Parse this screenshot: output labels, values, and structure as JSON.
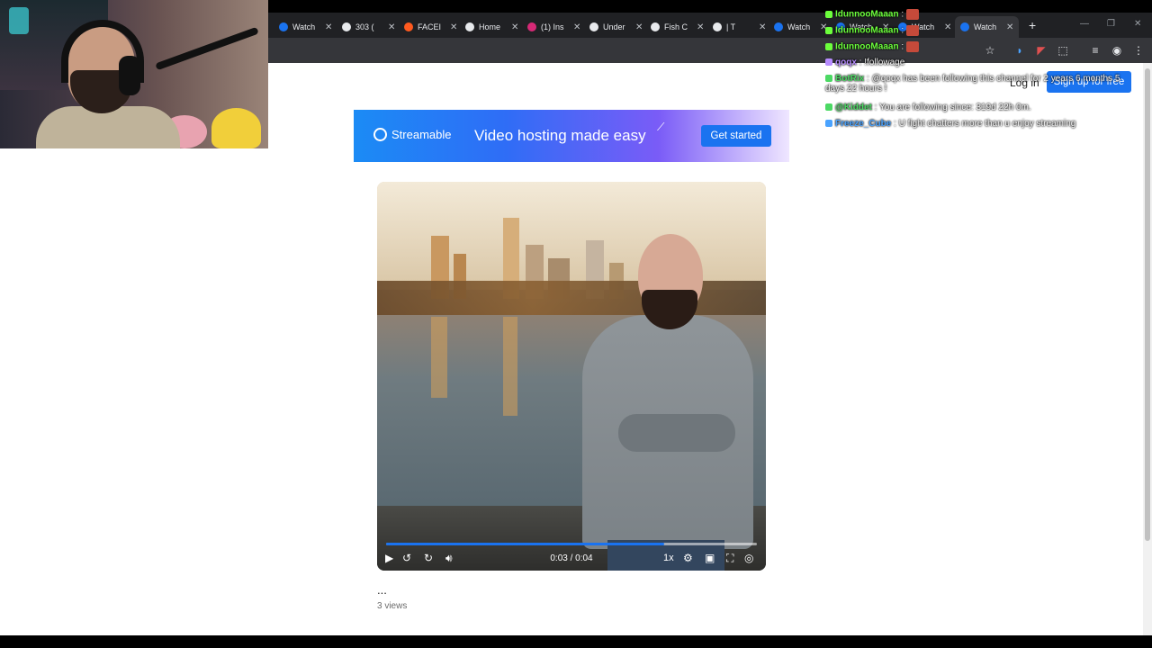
{
  "browser": {
    "tabs": [
      {
        "title": "Watch",
        "favicon_color": "#1a73f0"
      },
      {
        "title": "303 (",
        "favicon_color": "#e8eaed"
      },
      {
        "title": "FACEI",
        "favicon_color": "#ff5a1f"
      },
      {
        "title": "Home",
        "favicon_color": "#e8eaed"
      },
      {
        "title": "(1) Ins",
        "favicon_color": "#d62976"
      },
      {
        "title": "Under",
        "favicon_color": "#e8eaed"
      },
      {
        "title": "Fish C",
        "favicon_color": "#e8eaed"
      },
      {
        "title": "| T",
        "favicon_color": "#e8eaed"
      },
      {
        "title": "Watch",
        "favicon_color": "#1a73f0"
      },
      {
        "title": "Watch",
        "favicon_color": "#1a73f0"
      },
      {
        "title": "Watch",
        "favicon_color": "#1a73f0"
      },
      {
        "title": "Watch",
        "favicon_color": "#1a73f0",
        "active": true
      }
    ],
    "new_tab": "+",
    "close_glyph": "✕"
  },
  "header": {
    "login_label": "Log in",
    "signup_label": "Sign up for free"
  },
  "banner": {
    "brand": "Streamable",
    "tagline": "Video hosting made easy",
    "cta_label": "Get started"
  },
  "player": {
    "time": "0:03 / 0:04",
    "progress": 0.75,
    "speed": "1x"
  },
  "video": {
    "title": "...",
    "views": "3 views"
  },
  "chat": {
    "lines": [
      {
        "user": "IdunnooMaaan",
        "sep": " :",
        "message": "",
        "color": "#6cff3c",
        "emote": true
      },
      {
        "user": "IdunnooMaaan",
        "sep": " :",
        "message": "",
        "color": "#6cff3c",
        "emote": true
      },
      {
        "user": "IdunnooMaaan",
        "sep": " :",
        "message": "",
        "color": "#6cff3c",
        "emote": true
      },
      {
        "user": "qoqx",
        "sep": " :",
        "message": " !followage",
        "color": "#b78cff",
        "emote": false
      },
      {
        "user": "BotRix",
        "sep": " :",
        "message": " @qoqx has been following this channel for 2 years 6 months 5 days 22 hours !",
        "color": "#4cd964",
        "emote": false
      },
      {
        "user": "@Kiddet",
        "sep": " :",
        "message": " You are following since: 319d 22h 0m.",
        "color": "#4cd964",
        "emote": false
      },
      {
        "user": "Freeze_Cube",
        "sep": " :",
        "message": " U fight chatters more than u enjoy streaming",
        "color": "#4aa3ff",
        "emote": false
      }
    ]
  }
}
